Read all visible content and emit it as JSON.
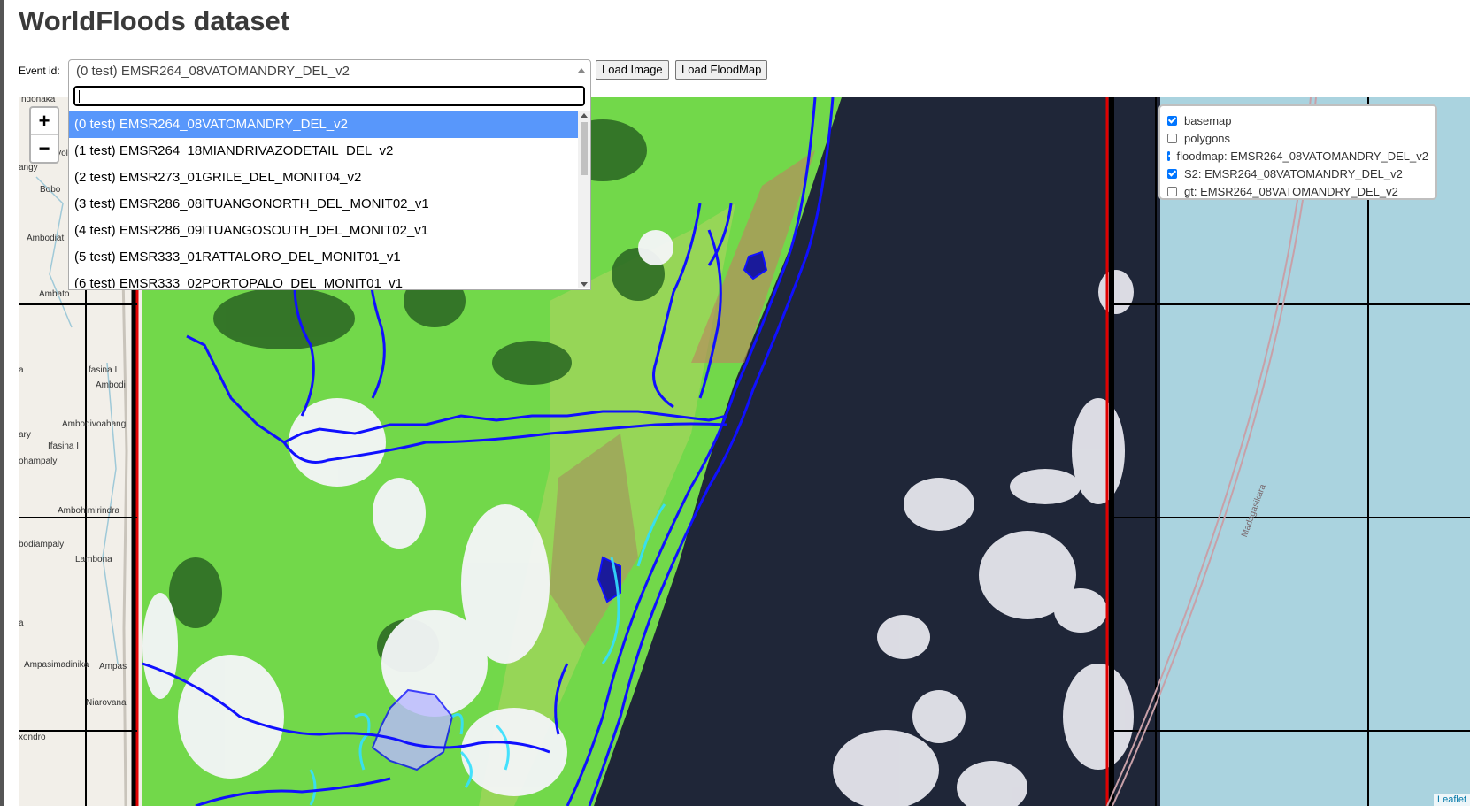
{
  "page": {
    "title": "WorldFloods dataset"
  },
  "controls": {
    "event_label": "Event id:",
    "selected_event": "(0 test) EMSR264_08VATOMANDRY_DEL_v2",
    "load_image": "Load Image",
    "load_floodmap": "Load FloodMap"
  },
  "dropdown": {
    "search_value": "",
    "options": [
      "(0 test) EMSR264_08VATOMANDRY_DEL_v2",
      "(1 test) EMSR264_18MIANDRIVAZODETAIL_DEL_v2",
      "(2 test) EMSR273_01GRILE_DEL_MONIT04_v2",
      "(3 test) EMSR286_08ITUANGONORTH_DEL_MONIT02_v1",
      "(4 test) EMSR286_09ITUANGOSOUTH_DEL_MONIT02_v1",
      "(5 test) EMSR333_01RATTALORO_DEL_MONIT01_v1",
      "(6 test) EMSR333_02PORTOPALO_DEL_MONIT01_v1"
    ]
  },
  "map": {
    "zoom_in": "+",
    "zoom_out": "−",
    "attribution": "Leaflet",
    "places": [
      "ndonaka",
      "Vol",
      "angy",
      "Bobo",
      "Ambodiat",
      "Ambato",
      "fasina I",
      "Ambodi",
      "a",
      "Ambodivoahang",
      "ary",
      "Ifasina I",
      "ohampaly",
      "Ambohimirindra",
      "bodiampaly",
      "Lambona",
      "a",
      "Ampasimadinika",
      "Ampas",
      "Niarovana",
      "xondro"
    ],
    "rail_label": "Madagasikara",
    "colors": {
      "flood_outline": "#1010ff",
      "sea": "#aad3df",
      "land": "#7be04a",
      "dark_sea": "#1c2235",
      "border": "#e00000"
    }
  },
  "layers": [
    {
      "label": "basemap",
      "checked": true
    },
    {
      "label": "polygons",
      "checked": false
    },
    {
      "label": "floodmap: EMSR264_08VATOMANDRY_DEL_v2",
      "checked": true
    },
    {
      "label": "S2: EMSR264_08VATOMANDRY_DEL_v2",
      "checked": true
    },
    {
      "label": "gt: EMSR264_08VATOMANDRY_DEL_v2",
      "checked": false
    }
  ]
}
